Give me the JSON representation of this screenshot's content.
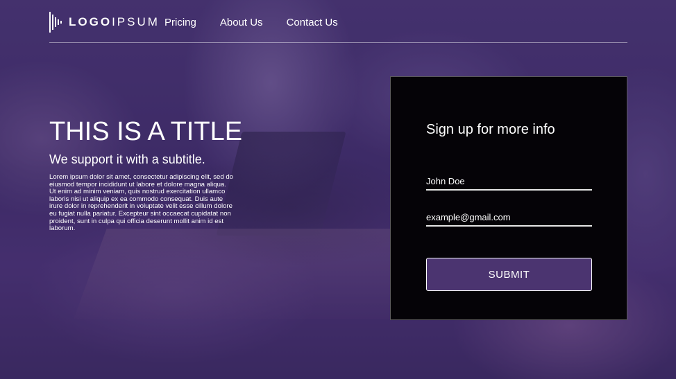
{
  "brand": {
    "logo_bold": "LOGO",
    "logo_light": "IPSUM"
  },
  "nav": {
    "items": [
      {
        "label": "Pricing"
      },
      {
        "label": "About Us"
      },
      {
        "label": "Contact Us"
      }
    ]
  },
  "hero": {
    "title": "THIS IS A TITLE",
    "subtitle": "We support it with a subtitle.",
    "body": "Lorem ipsum dolor sit amet, consectetur adipiscing elit, sed do eiusmod tempor incididunt ut labore et dolore magna aliqua. Ut enim ad minim veniam, quis nostrud exercitation ullamco laboris nisi ut aliquip ex ea commodo consequat. Duis aute irure dolor in reprehenderit in voluptate velit esse cillum dolore eu fugiat nulla pariatur. Excepteur sint occaecat cupidatat non proident, sunt in culpa qui officia deserunt mollit anim id est laborum."
  },
  "signup": {
    "heading": "Sign up for more info",
    "name_value": "John Doe",
    "email_value": "example@gmail.com",
    "submit_label": "SUBMIT"
  },
  "colors": {
    "overlay": "#3b2a5e",
    "card_bg": "#050307",
    "button_bg": "#4b3470",
    "text": "#ffffff"
  },
  "icons": {
    "logo": "soundwave-logo-icon"
  }
}
